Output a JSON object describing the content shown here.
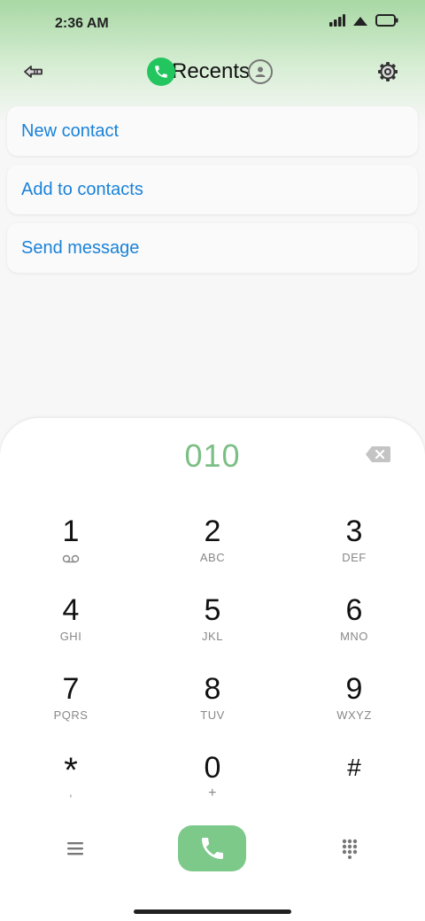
{
  "status_bar": {
    "time": "2:36 AM"
  },
  "header": {
    "title": "Recents"
  },
  "actions": [
    {
      "label": "New contact"
    },
    {
      "label": "Add to contacts"
    },
    {
      "label": "Send message"
    }
  ],
  "dialer": {
    "number": "010",
    "keys": [
      {
        "digit": "1",
        "sub": ""
      },
      {
        "digit": "2",
        "sub": "ABC"
      },
      {
        "digit": "3",
        "sub": "DEF"
      },
      {
        "digit": "4",
        "sub": "GHI"
      },
      {
        "digit": "5",
        "sub": "JKL"
      },
      {
        "digit": "6",
        "sub": "MNO"
      },
      {
        "digit": "7",
        "sub": "PQRS"
      },
      {
        "digit": "8",
        "sub": "TUV"
      },
      {
        "digit": "9",
        "sub": "WXYZ"
      },
      {
        "digit": "*",
        "sub": ","
      },
      {
        "digit": "0",
        "sub": "+"
      },
      {
        "digit": "#",
        "sub": ""
      }
    ]
  },
  "colors": {
    "accent_green": "#22c55e",
    "call_button": "#7cc98a",
    "number_text": "#7bbf85",
    "action_text": "#1a82d8"
  }
}
